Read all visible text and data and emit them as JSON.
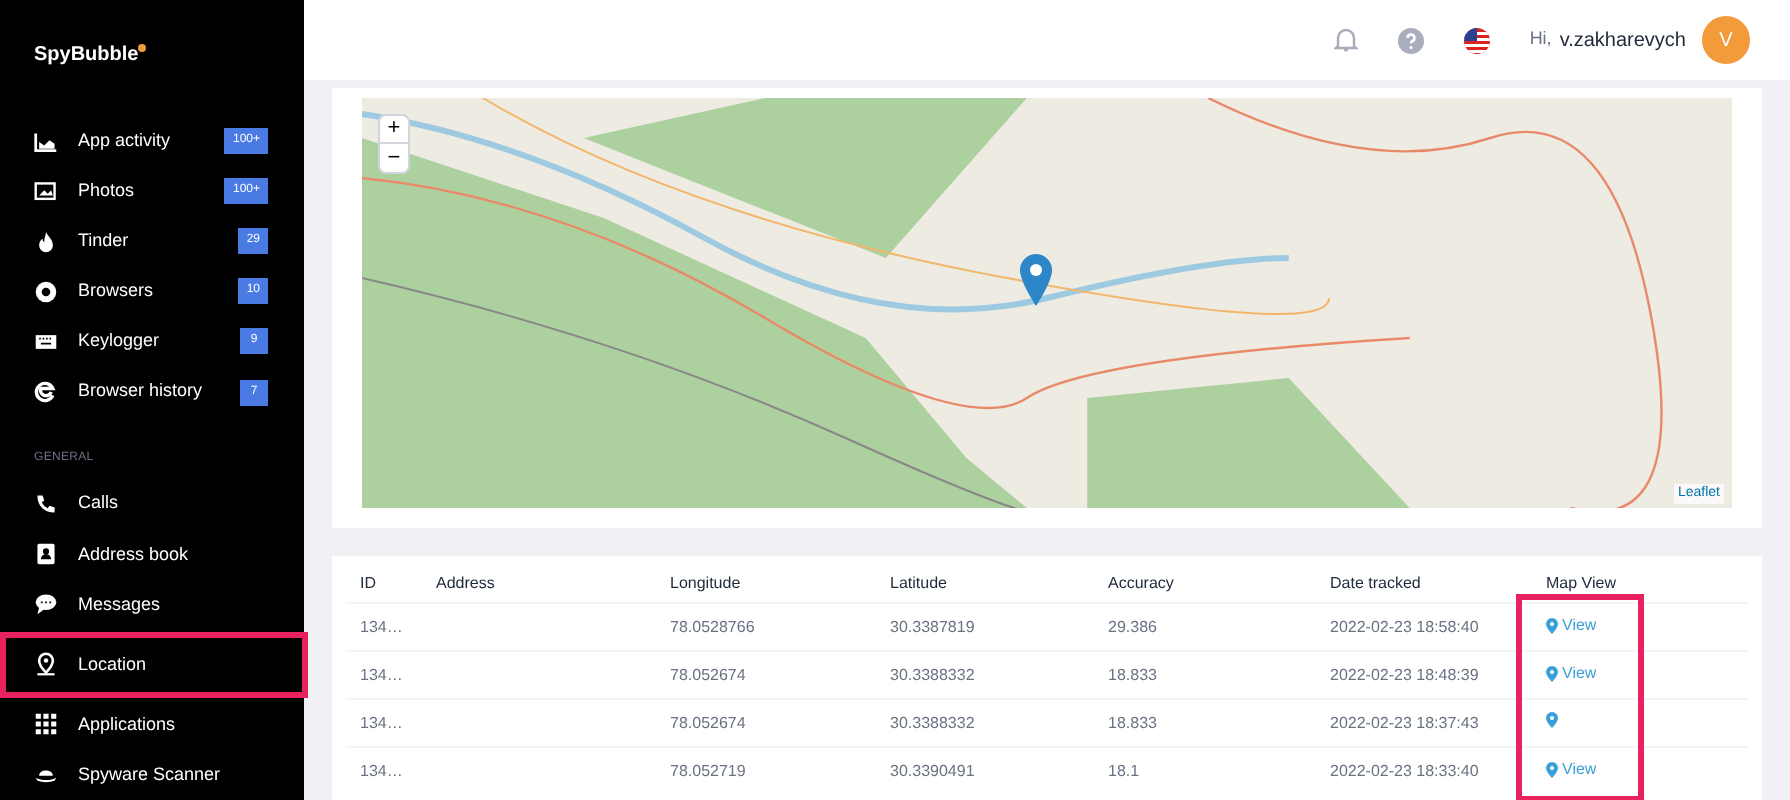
{
  "brand": {
    "name": "SpyBubble"
  },
  "sidebar": {
    "items": [
      {
        "label": "App activity",
        "badge": "100+",
        "selected": false
      },
      {
        "label": "Photos",
        "badge": "100+",
        "selected": false
      },
      {
        "label": "Tinder",
        "badge": "29",
        "selected": false
      },
      {
        "label": "Browsers",
        "badge": "10",
        "selected": false
      },
      {
        "label": "Keylogger",
        "badge": "9",
        "selected": false
      },
      {
        "label": "Browser history",
        "badge": "7",
        "selected": false
      }
    ],
    "section_title": "GENERAL",
    "general_items": [
      {
        "label": "Calls",
        "selected": false
      },
      {
        "label": "Address book",
        "selected": false
      },
      {
        "label": "Messages",
        "selected": false
      },
      {
        "label": "Location",
        "selected": true
      },
      {
        "label": "Applications",
        "selected": false
      },
      {
        "label": "Spyware Scanner",
        "selected": false
      }
    ]
  },
  "header": {
    "greeting": "Hi,",
    "username": "v.zakharevych",
    "avatar_letter": "V"
  },
  "map": {
    "zoom_in": "+",
    "zoom_out": "−",
    "attribution": "Leaflet"
  },
  "table": {
    "columns": [
      "ID",
      "Address",
      "Longitude",
      "Latitude",
      "Accuracy",
      "Date tracked",
      "Map View"
    ],
    "rows": [
      {
        "id": "134…",
        "longitude": "78.0528766",
        "latitude": "30.3387819",
        "accuracy": "29.386",
        "date": "2022-02-23 18:58:40",
        "view": "View"
      },
      {
        "id": "134…",
        "longitude": "78.052674",
        "latitude": "30.3388332",
        "accuracy": "18.833",
        "date": "2022-02-23 18:48:39",
        "view": "View"
      },
      {
        "id": "134…",
        "longitude": "78.052674",
        "latitude": "30.3388332",
        "accuracy": "18.833",
        "date": "2022-02-23 18:37:43"
      },
      {
        "id": "134…",
        "longitude": "78.052719",
        "latitude": "30.3390491",
        "accuracy": "18.1",
        "date": "2022-02-23 18:33:40",
        "view": "View"
      }
    ]
  }
}
